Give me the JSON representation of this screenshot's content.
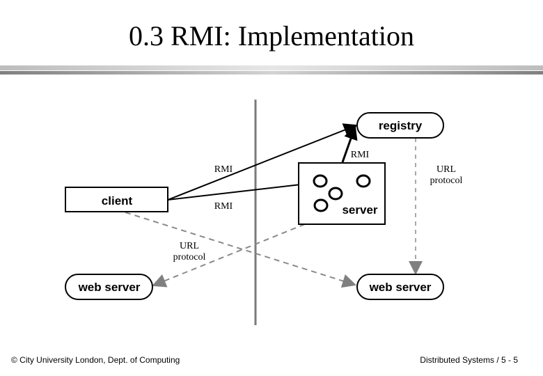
{
  "slide": {
    "title": "0.3 RMI: Implementation",
    "footer_left": "© City University London, Dept. of Computing",
    "footer_right": "Distributed Systems / 5 - 5"
  },
  "diagram": {
    "nodes": {
      "client": "client",
      "server": "server",
      "registry": "registry",
      "web_server_left": "web server",
      "web_server_right": "web server"
    },
    "edge_labels": {
      "client_registry": "RMI",
      "client_server": "RMI",
      "server_registry": "RMI",
      "url_protocol_left_line1": "URL",
      "url_protocol_left_line2": "protocol",
      "url_protocol_right_line1": "URL",
      "url_protocol_right_line2": "protocol"
    },
    "colors": {
      "solid_edge": "#000000",
      "dashed_edge": "#8a8a8a",
      "divider": "#7a7a7a"
    }
  }
}
